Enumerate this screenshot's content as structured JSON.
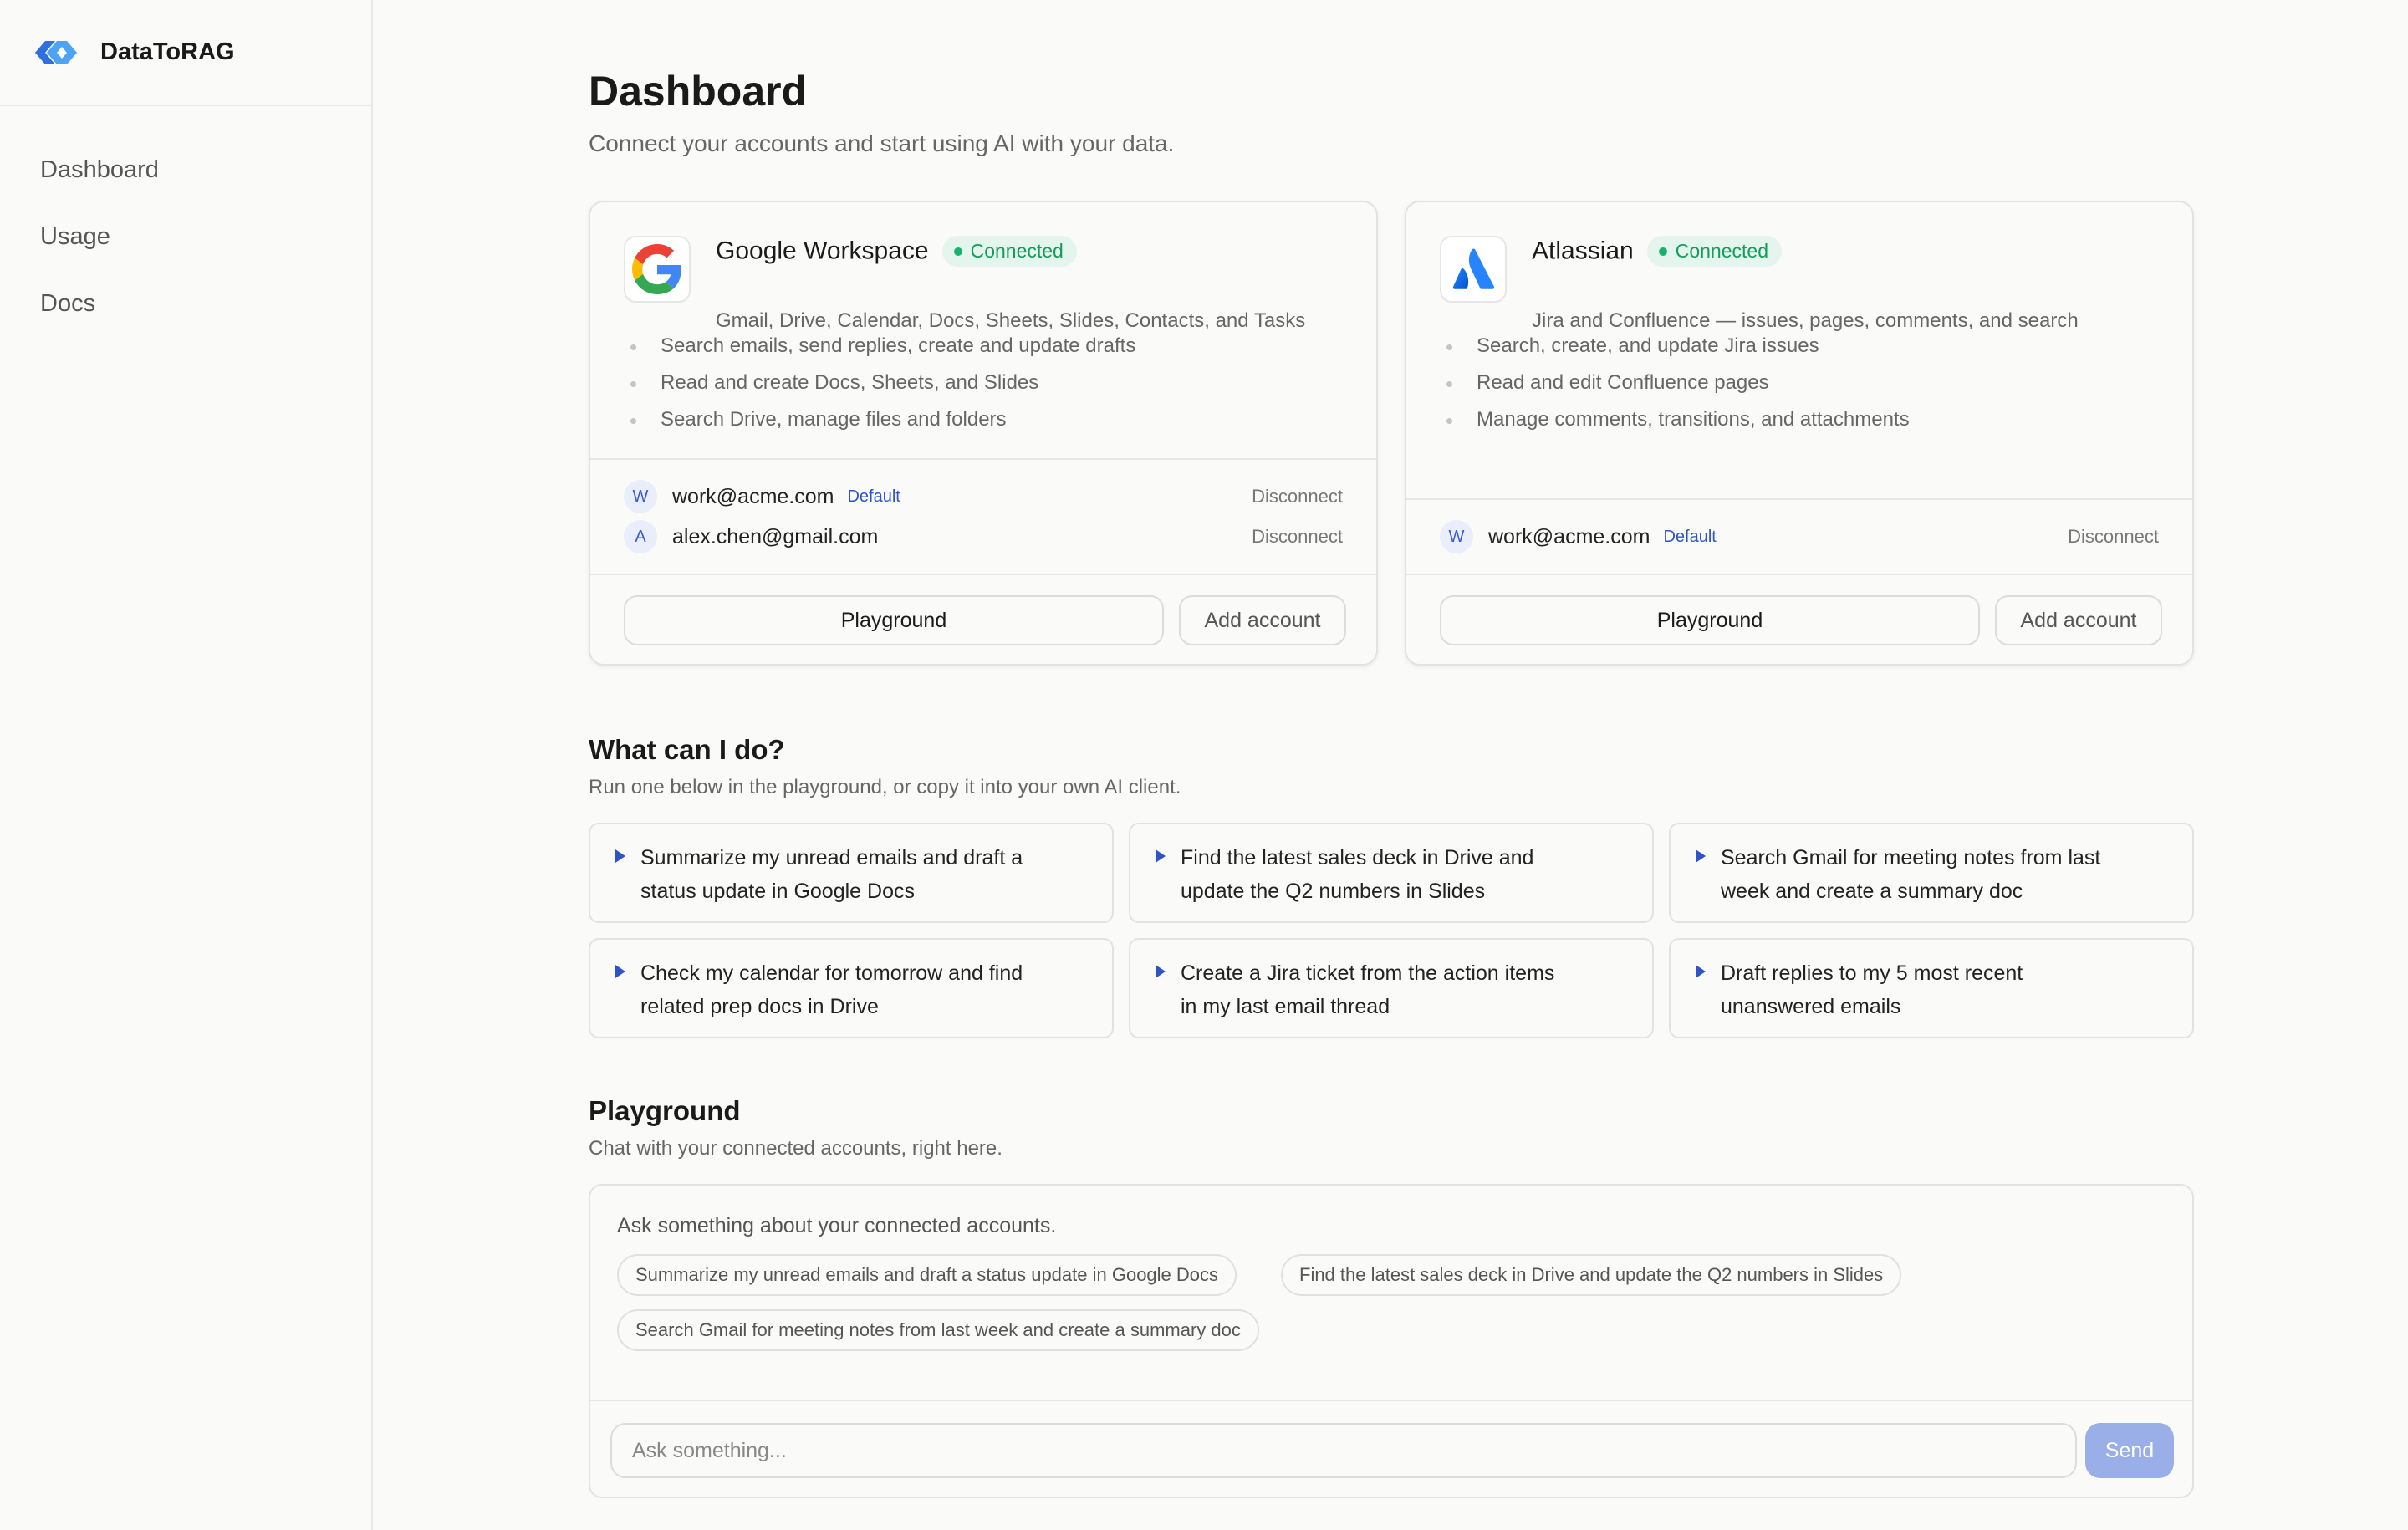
{
  "brand": {
    "name": "DataToRAG"
  },
  "nav": [
    {
      "label": "Dashboard"
    },
    {
      "label": "Usage"
    },
    {
      "label": "Docs"
    }
  ],
  "header": {
    "title": "Dashboard",
    "subtitle": "Connect your accounts and start using AI with your data."
  },
  "services": [
    {
      "name": "Google Workspace",
      "status": "Connected",
      "description": "Gmail, Drive, Calendar, Docs, Sheets, Slides, Contacts, and Tasks",
      "features": [
        "Search emails, send replies, create and update drafts",
        "Read and create Docs, Sheets, and Slides",
        "Search Drive, manage files and folders"
      ],
      "accounts": [
        {
          "initial": "W",
          "email": "work@acme.com",
          "tag": "Default",
          "action": "Disconnect"
        },
        {
          "initial": "A",
          "email": "alex.chen@gmail.com",
          "tag": "",
          "action": "Disconnect"
        }
      ],
      "playground_label": "Playground",
      "add_label": "Add account"
    },
    {
      "name": "Atlassian",
      "status": "Connected",
      "description": "Jira and Confluence — issues, pages, comments, and search",
      "features": [
        "Search, create, and update Jira issues",
        "Read and edit Confluence pages",
        "Manage comments, transitions, and attachments"
      ],
      "accounts": [
        {
          "initial": "W",
          "email": "work@acme.com",
          "tag": "Default",
          "action": "Disconnect"
        }
      ],
      "playground_label": "Playground",
      "add_label": "Add account"
    }
  ],
  "what": {
    "title": "What can I do?",
    "subtitle": "Run one below in the playground, or copy it into your own AI client.",
    "prompts": [
      {
        "line1": "Summarize my unread emails and draft a",
        "line2": "status update in Google Docs"
      },
      {
        "line1": "Find the latest sales deck in Drive and",
        "line2": "update the Q2 numbers in Slides"
      },
      {
        "line1": "Search Gmail for meeting notes from last",
        "line2": "week and create a summary doc"
      },
      {
        "line1": "Check my calendar for tomorrow and find",
        "line2": "related prep docs in Drive"
      },
      {
        "line1": "Create a Jira ticket from the action items",
        "line2": "in my last email thread"
      },
      {
        "line1": "Draft replies to my 5 most recent",
        "line2": "unanswered emails"
      }
    ]
  },
  "playground": {
    "title": "Playground",
    "subtitle": "Chat with your connected accounts, right here.",
    "hint": "Ask something about your connected accounts.",
    "chips": [
      "Summarize my unread emails and draft a status update in Google Docs",
      "Find the latest sales deck in Drive and update the Q2 numbers in Slides",
      "Search Gmail for meeting notes from last week and create a summary doc"
    ],
    "input_placeholder": "Ask something...",
    "send_label": "Send"
  },
  "colors": {
    "accent": "#2f54c7",
    "connected_bg": "#e3f5ec",
    "connected_text": "#139c5a",
    "send_button": "#9aaee8"
  },
  "icons": {
    "brand": "datatorag-logo-icon",
    "google": "google-g-logo-icon",
    "atlassian": "atlassian-logo-icon",
    "prompt": "play-triangle-icon"
  }
}
